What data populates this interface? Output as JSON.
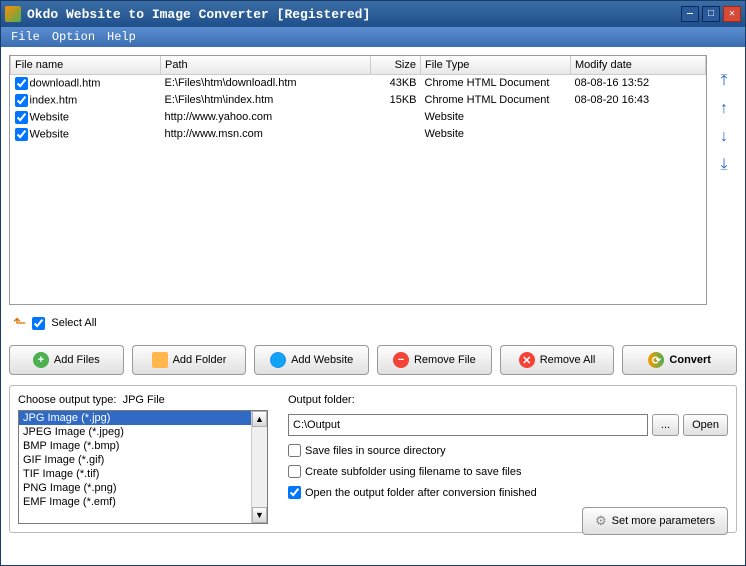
{
  "titlebar": {
    "title": "Okdo Website to Image Converter [Registered]"
  },
  "menu": {
    "file": "File",
    "option": "Option",
    "help": "Help"
  },
  "table": {
    "headers": {
      "filename": "File name",
      "path": "Path",
      "size": "Size",
      "filetype": "File Type",
      "modify": "Modify date"
    },
    "rows": [
      {
        "checked": true,
        "name": "downloadl.htm",
        "path": "E:\\Files\\htm\\downloadl.htm",
        "size": "43KB",
        "type": "Chrome HTML Document",
        "modify": "08-08-16 13:52"
      },
      {
        "checked": true,
        "name": "index.htm",
        "path": "E:\\Files\\htm\\index.htm",
        "size": "15KB",
        "type": "Chrome HTML Document",
        "modify": "08-08-20 16:43"
      },
      {
        "checked": true,
        "name": "Website",
        "path": "http://www.yahoo.com",
        "size": "",
        "type": "Website",
        "modify": ""
      },
      {
        "checked": true,
        "name": "Website",
        "path": "http://www.msn.com",
        "size": "",
        "type": "Website",
        "modify": ""
      }
    ]
  },
  "selectall": {
    "label": "Select All",
    "checked": true
  },
  "buttons": {
    "addfiles": "Add Files",
    "addfolder": "Add Folder",
    "addwebsite": "Add Website",
    "removefile": "Remove File",
    "removeall": "Remove All",
    "convert": "Convert"
  },
  "output_type": {
    "label": "Choose output type:",
    "current": "JPG File",
    "options": [
      "JPG Image (*.jpg)",
      "JPEG Image (*.jpeg)",
      "BMP Image (*.bmp)",
      "GIF Image (*.gif)",
      "TIF Image (*.tif)",
      "PNG Image (*.png)",
      "EMF Image (*.emf)"
    ],
    "selected_index": 0
  },
  "output_folder": {
    "label": "Output folder:",
    "value": "C:\\Output",
    "browse": "...",
    "open": "Open"
  },
  "options": {
    "save_source": {
      "label": "Save files in source directory",
      "checked": false
    },
    "subfolder": {
      "label": "Create subfolder using filename to save files",
      "checked": false
    },
    "open_after": {
      "label": "Open the output folder after conversion finished",
      "checked": true
    }
  },
  "params_btn": "Set more parameters"
}
